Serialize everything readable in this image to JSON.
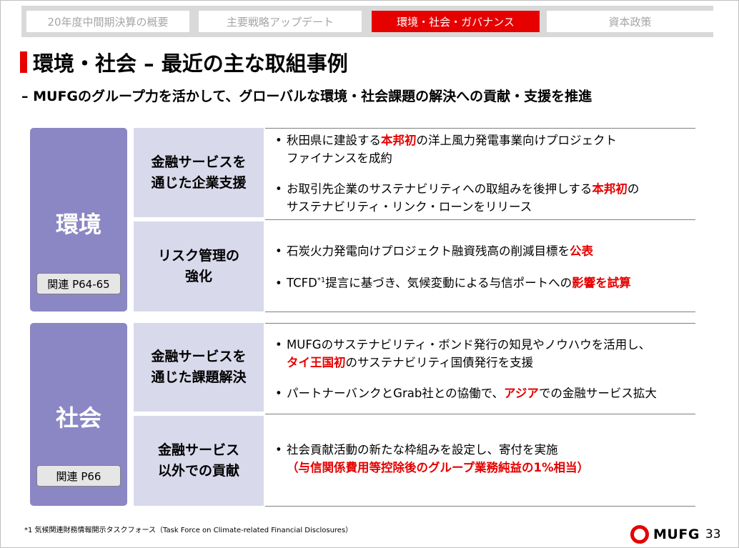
{
  "tabs": [
    {
      "label": "20年度中間期決算の概要"
    },
    {
      "label": "主要戦略アップデート"
    },
    {
      "label": "環境・社会・ガバナンス"
    },
    {
      "label": "資本政策"
    }
  ],
  "title": "環境・社会 – 最近の主な取組事例",
  "subtitle": "– MUFGのグループ力を活かして、グローバルな環境・社会課題の解決への貢献・支援を推進",
  "environment": {
    "label": "環境",
    "ref": "関連 P64-65",
    "sub1": {
      "line1": "金融サービスを",
      "line2": "通じた企業支援"
    },
    "sub2": {
      "line1": "リスク管理の",
      "line2": "強化"
    },
    "b1": {
      "pre": "秋田県に建設する",
      "red": "本邦初",
      "post": "の洋上風力発電事業向けプロジェクト",
      "cont": "ファイナンスを成約"
    },
    "b2": {
      "pre": "お取引先企業のサステナビリティへの取組みを後押しする",
      "red": "本邦初",
      "post": "の",
      "cont": "サステナビリティ・リンク・ローンをリリース"
    },
    "b3": {
      "pre": "石炭火力発電向けプロジェクト融資残高の削減目標を",
      "red": "公表"
    },
    "b4": {
      "pre": "TCFD",
      "sup": "*1",
      "mid": "提言に基づき、気候変動による与信ポートへの",
      "red": "影響を試算"
    }
  },
  "society": {
    "label": "社会",
    "ref": "関連 P66",
    "sub1": {
      "line1": "金融サービスを",
      "line2": "通じた課題解決"
    },
    "sub2": {
      "line1": "金融サービス",
      "line2": "以外での貢献"
    },
    "b1": {
      "pre": "MUFGのサステナビリティ・ボンド発行の知見やノウハウを活用し、",
      "red": "タイ王国初",
      "post": "のサステナビリティ国債発行を支援"
    },
    "b2": {
      "pre": "パートナーバンクとGrab社との協働で、",
      "red": "アジア",
      "post": "での金融サービス拡大"
    },
    "b3": {
      "pre": "社会貢献活動の新たな枠組みを設定し、寄付を実施",
      "red": "（与信関係費用等控除後のグループ業務純益の1%相当）"
    }
  },
  "bullet_char": "•",
  "footnote": "*1  気候関連財務情報開示タスクフォース（Task Force on Climate-related Financial Disclosures）",
  "logo_text": "MUFG",
  "page_number": "33"
}
